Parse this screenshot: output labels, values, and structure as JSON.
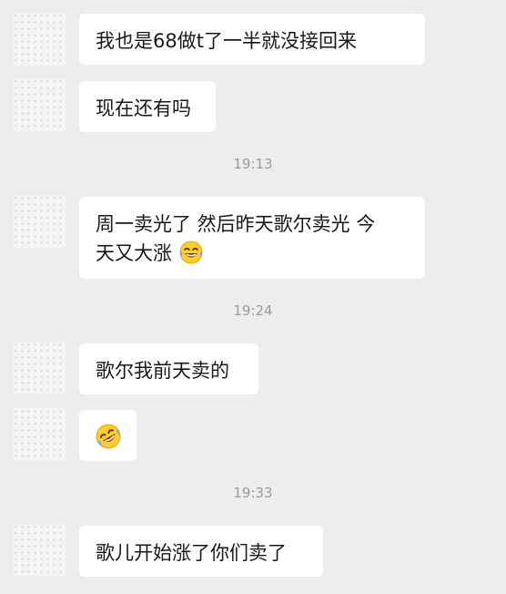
{
  "messages": [
    {
      "text": "我也是68做t了一半就没接回来"
    },
    {
      "text": "现在还有吗"
    },
    {
      "timestamp": "19:13"
    },
    {
      "text_line1": "周一卖光了  然后昨天歌尔卖光  今",
      "text_line2": "天又大涨",
      "emoji": "face-with-tears-of-joy-icon"
    },
    {
      "timestamp": "19:24"
    },
    {
      "text": "歌尔我前天卖的"
    },
    {
      "emoji": "rolling-on-floor-laughing-icon"
    },
    {
      "timestamp": "19:33"
    },
    {
      "text": "歌儿开始涨了你们卖了"
    }
  ]
}
